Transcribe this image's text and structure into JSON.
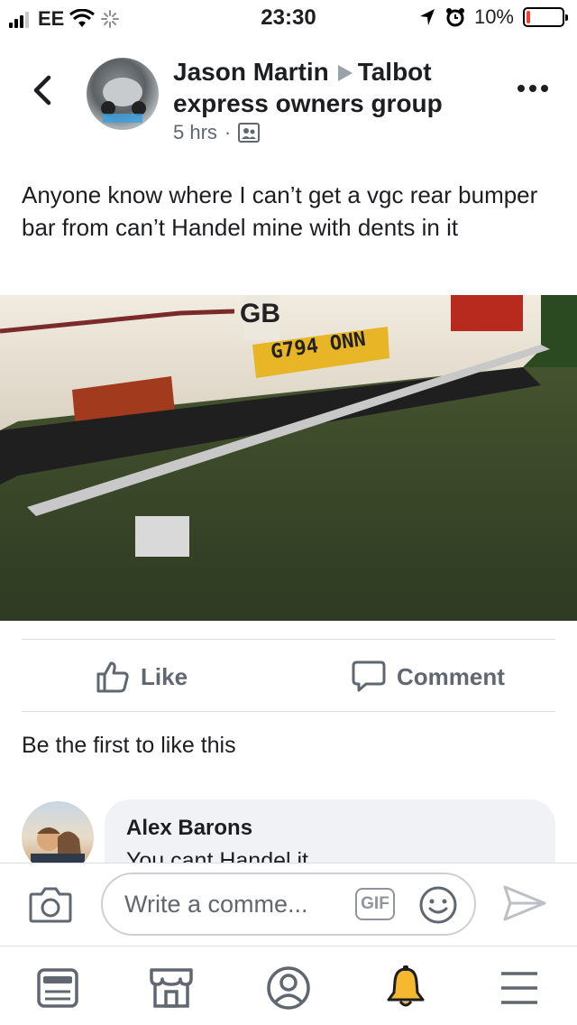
{
  "status_bar": {
    "carrier": "EE",
    "time": "23:30",
    "battery": "10%",
    "battery_level": 0.1,
    "battery_color": "#ff3b30"
  },
  "post": {
    "author": "Jason Martin",
    "group": "Talbot express owners group",
    "time": "5 hrs",
    "separator": "·",
    "audience_icon": "group-audience-icon",
    "text": "Anyone know where I can’t get a vgc rear bumper bar from can’t Handel mine with dents in it",
    "photo_plate": "G794 ONN",
    "photo_gb": "GB"
  },
  "actions": {
    "like": "Like",
    "comment": "Comment"
  },
  "likes_summary": "Be the first to like this",
  "comment": {
    "name": "Alex Barons",
    "text": "You cant Handel it"
  },
  "composer": {
    "placeholder": "Write a comme...",
    "gif": "GIF"
  },
  "tabs": [
    "news-feed-icon",
    "marketplace-icon",
    "profile-icon",
    "notifications-icon",
    "menu-icon"
  ],
  "colors": {
    "accent": "#1877f2",
    "gray_text": "#606770",
    "bell": "#f5b82e"
  }
}
